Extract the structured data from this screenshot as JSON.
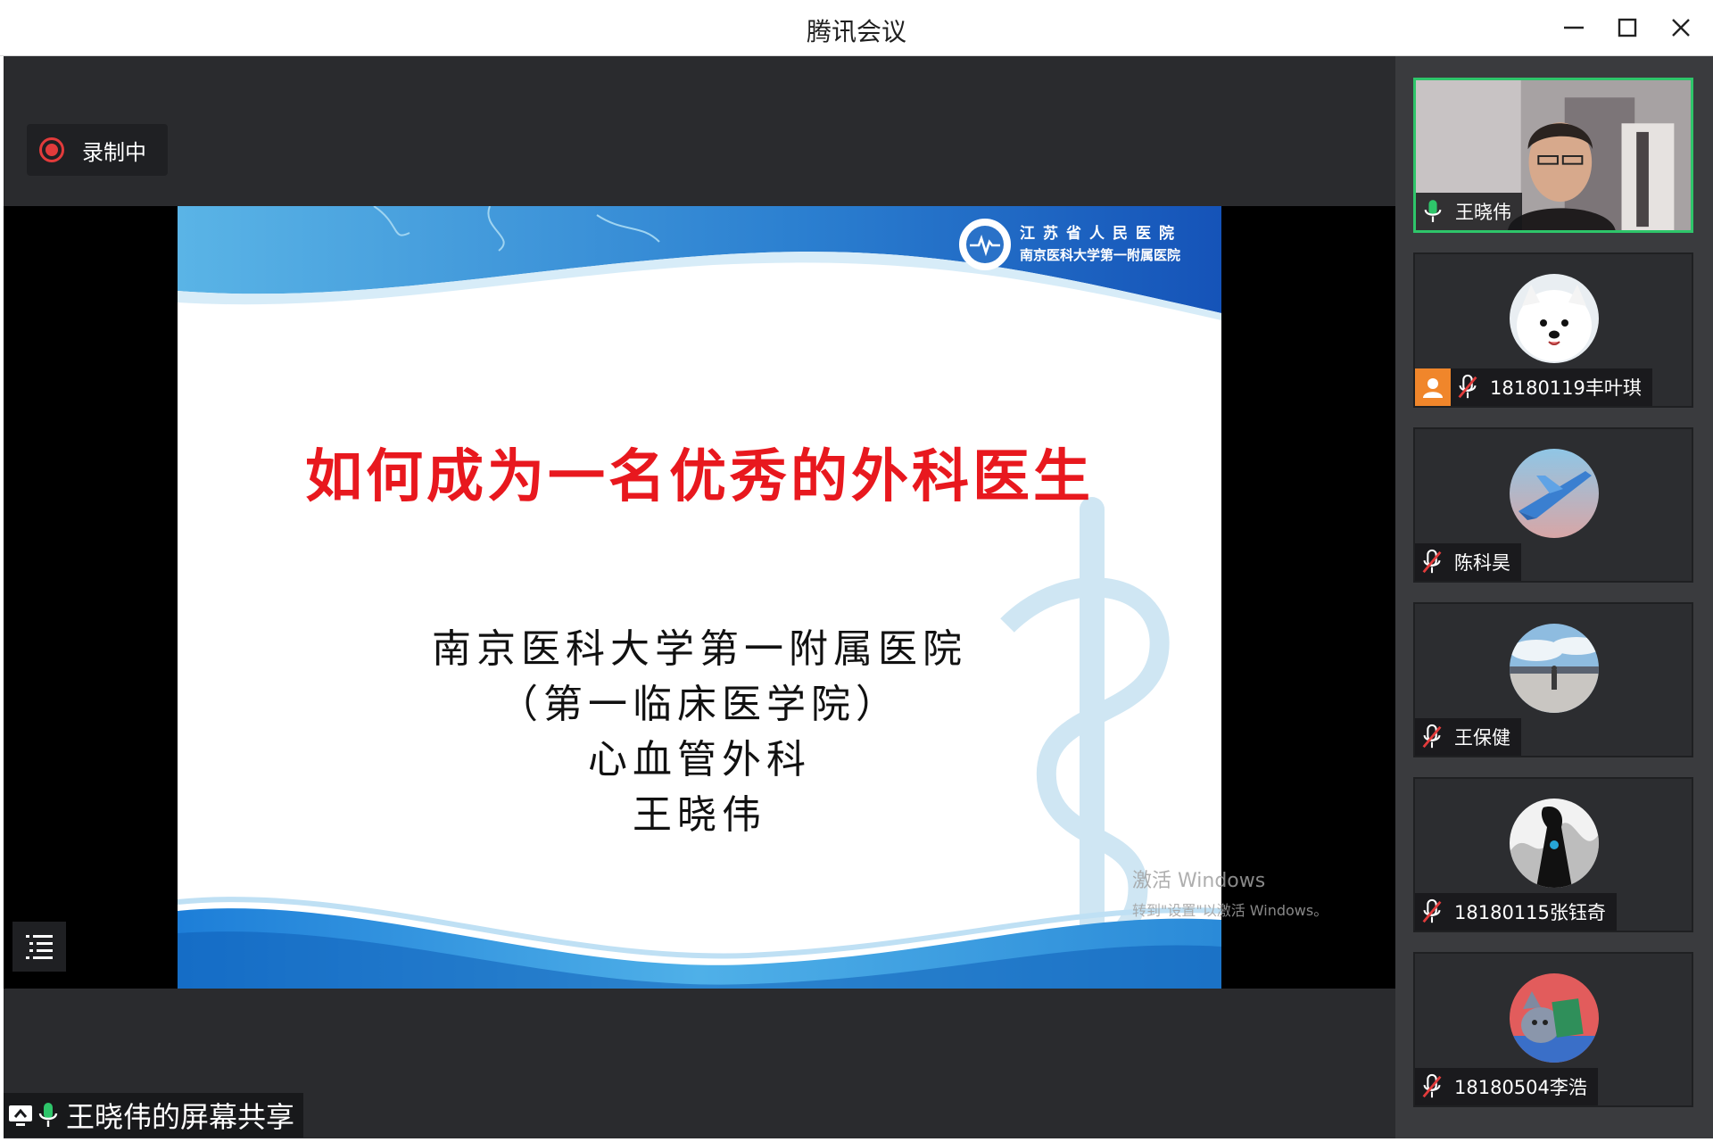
{
  "window": {
    "title": "腾讯会议"
  },
  "recording": {
    "label": "录制中",
    "color": "#e23b3b"
  },
  "slide": {
    "logo_line1": "江苏省人民医院",
    "logo_line2": "南京医科大学第一附属医院",
    "title": "如何成为一名优秀的外科医生",
    "lines": [
      "南京医科大学第一附属医院",
      "（第一临床医学院）",
      "心血管外科",
      "王晓伟"
    ],
    "title_color": "#e8181e"
  },
  "watermark": {
    "line1": "激活 Windows",
    "line2": "转到\"设置\"以激活 Windows。"
  },
  "share": {
    "label": "王晓伟的屏幕共享"
  },
  "participants": [
    {
      "name": "王晓伟",
      "mic": "mic-on-icon",
      "active": true
    },
    {
      "name": "18180119丰叶琪",
      "mic": "mic-muted-icon",
      "active": false
    },
    {
      "name": "陈科昊",
      "mic": "mic-muted-icon",
      "active": false
    },
    {
      "name": "王保健",
      "mic": "mic-muted-icon",
      "active": false
    },
    {
      "name": "18180115张钰奇",
      "mic": "mic-muted-icon",
      "active": false
    },
    {
      "name": "18180504李浩",
      "mic": "mic-muted-icon",
      "active": false
    }
  ],
  "colors": {
    "active_border": "#2ec56a",
    "stage_bg": "#2a2b2e",
    "sidebar_bg": "#3a3b3e"
  }
}
